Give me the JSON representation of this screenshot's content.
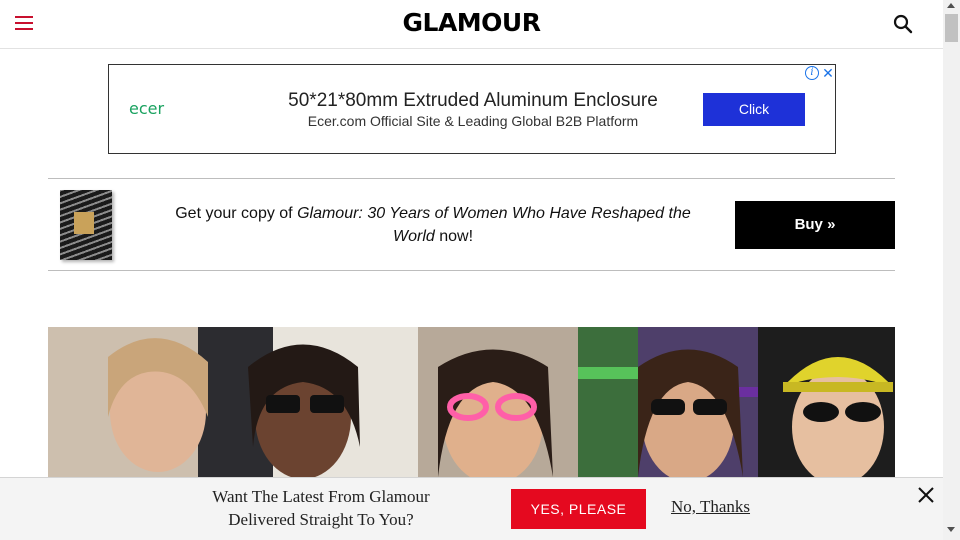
{
  "header": {
    "logo": "GLAMOUR",
    "menu_icon": "hamburger-menu-icon",
    "search_icon": "search-icon",
    "accent_color": "#c8102e"
  },
  "ad": {
    "brand": "ecer",
    "headline": "50*21*80mm Extruded Aluminum Enclosure",
    "subline": "Ecer.com Official Site & Leading Global B2B Platform",
    "cta": "Click",
    "info_icon": "info-icon",
    "close_icon": "close-icon",
    "cta_color": "#1e31d8"
  },
  "promo": {
    "text_before": "Get your copy of ",
    "title": "Glamour: 30 Years of Women Who Have Reshaped the World",
    "text_after": " now!",
    "button": "Buy »"
  },
  "hero": {
    "image_icon": "hero-photo-women-in-sunglasses"
  },
  "newsletter": {
    "line1": "Want The Latest From Glamour",
    "line2": "Delivered Straight To You?",
    "yes": "YES, PLEASE",
    "no": "No, Thanks",
    "close_icon": "close-icon",
    "yes_color": "#e5091f"
  }
}
